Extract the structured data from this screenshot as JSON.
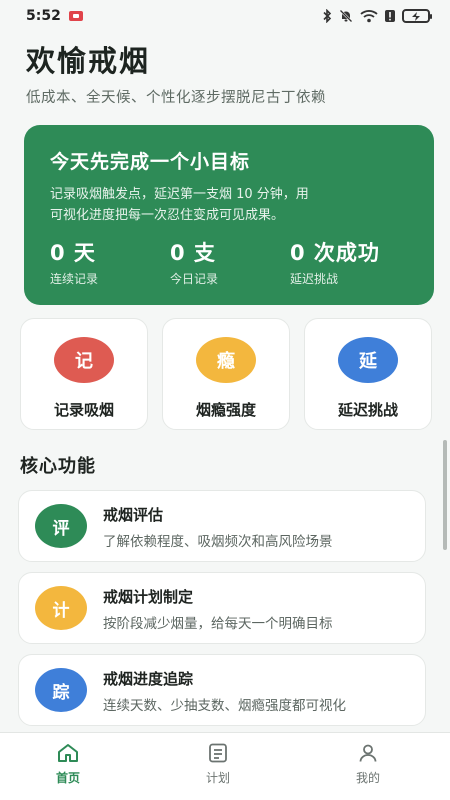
{
  "status_bar": {
    "time": "5:52"
  },
  "header": {
    "title": "欢愉戒烟",
    "subtitle": "低成本、全天候、个性化逐步摆脱尼古丁依赖"
  },
  "hero": {
    "title": "今天先完成一个小目标",
    "desc_line1": "记录吸烟触发点，延迟第一支烟 10 分钟，用",
    "desc_line2": "可视化进度把每一次忍住变成可见成果。",
    "stats": [
      {
        "value": "0 天",
        "label": "连续记录"
      },
      {
        "value": "0 支",
        "label": "今日记录"
      },
      {
        "value": "0 次成功",
        "label": "延迟挑战"
      }
    ],
    "color": "#2e8b57"
  },
  "actions": [
    {
      "icon_char": "记",
      "label": "记录吸烟",
      "color": "#de5b52"
    },
    {
      "icon_char": "瘾",
      "label": "烟瘾强度",
      "color": "#f3b73e"
    },
    {
      "icon_char": "延",
      "label": "延迟挑战",
      "color": "#3f7fd9"
    }
  ],
  "section": {
    "title": "核心功能"
  },
  "features": [
    {
      "icon_char": "评",
      "title": "戒烟评估",
      "desc": "了解依赖程度、吸烟频次和高风险场景",
      "color": "#2e8b57"
    },
    {
      "icon_char": "计",
      "title": "戒烟计划制定",
      "desc": "按阶段减少烟量，给每天一个明确目标",
      "color": "#f3b73e"
    },
    {
      "icon_char": "踪",
      "title": "戒烟进度追踪",
      "desc": "连续天数、少抽支数、烟瘾强度都可视化",
      "color": "#3f7fd9"
    }
  ],
  "bottom_nav": [
    {
      "label": "首页",
      "icon": "home-icon",
      "active": true
    },
    {
      "label": "计划",
      "icon": "plan-icon",
      "active": false
    },
    {
      "label": "我的",
      "icon": "user-icon",
      "active": false
    }
  ],
  "accent_color": "#2e8b57"
}
